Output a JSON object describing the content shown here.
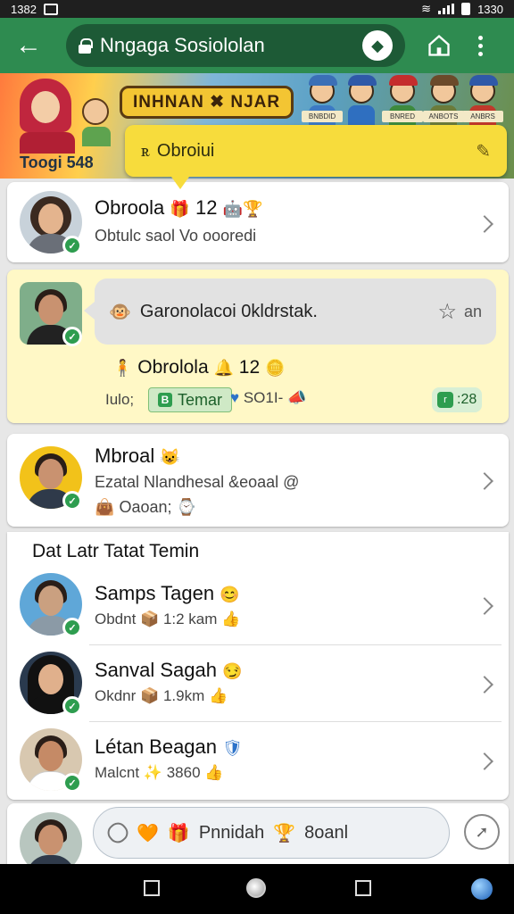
{
  "status_bar": {
    "time_left": "1382",
    "time_right": "1330"
  },
  "app_bar": {
    "title": "Nngaga Sosiololan"
  },
  "banner": {
    "title": "INHNAN ✖ NJAR",
    "subtitle": "Toogi 548",
    "tags": [
      "BNBDID",
      "BNRED",
      "ANBOTS",
      "ANBRS"
    ]
  },
  "tooltip": {
    "text": "Obroiui"
  },
  "chats": [
    {
      "name": "Obroola",
      "badge": "12",
      "preview": "Obtulc saol Vo oooredi",
      "emoji_name": "🎁",
      "emoji_after": "🤖🏆",
      "preview_icon": "👍"
    },
    {
      "name": "Obrolola",
      "badge": "12",
      "bubble": "Garonolacoi 0kldrstak.",
      "bubble_side": "an",
      "label_left": "Iulo;",
      "chip": "Temar",
      "after_chip": "SO1I-",
      "right_badge": ":28"
    },
    {
      "name": "Mbroal",
      "preview": "Ezatal Nlandhesal &eoaal",
      "status": "Oaoan;"
    }
  ],
  "section": {
    "title": "Dat Latr Tatat Temin"
  },
  "contacts": [
    {
      "name": "Samps Tagen",
      "detail": "Obdnt",
      "distance": "1:2 kam",
      "emoji": "😊"
    },
    {
      "name": "Sanval Sagah",
      "detail": "Okdnr",
      "distance": "1.9km",
      "emoji": "😏"
    },
    {
      "name": "Létan Beagan",
      "detail": "Malcnt",
      "distance": "3860",
      "emoji": "🛡"
    }
  ],
  "compose": {
    "placeholder": "Pnnidah",
    "extra": "8oanl"
  },
  "colors": {
    "primary": "#2e8b50",
    "highlight": "#fff8c6",
    "tooltip": "#f7dc3c",
    "verified": "#2e9d4f"
  }
}
